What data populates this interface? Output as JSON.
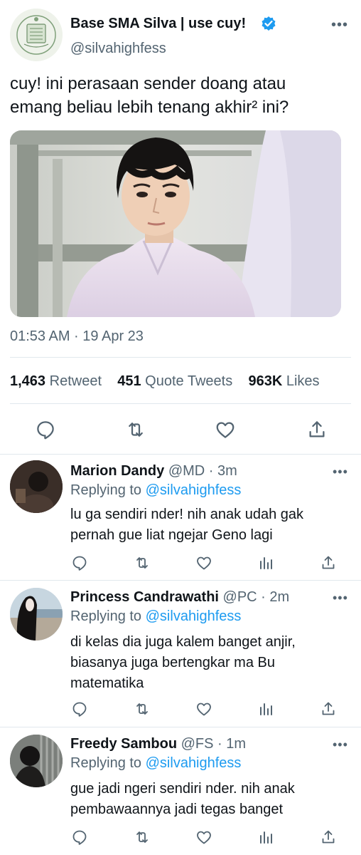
{
  "main_tweet": {
    "author_name": "Base SMA Silva | use cuy!",
    "author_handle": "@silvahighfess",
    "text_line1": "cuy! ini perasaan sender doang atau",
    "text_line2": "emang beliau lebih tenang akhir² ini?",
    "timestamp": "01:53 AM · 19 Apr 23",
    "stats": {
      "retweets": "1,463",
      "retweets_label": "Retweet",
      "quotes": "451",
      "quotes_label": "Quote Tweets",
      "likes": "963K",
      "likes_label": "Likes"
    },
    "more_label": "•••",
    "actions": [
      "reply-icon",
      "retweet-icon",
      "like-icon",
      "share-icon"
    ],
    "media_icon": "photo-of-student"
  },
  "replies": [
    {
      "name": "Marion Dandy",
      "meta": "@MD · 3m",
      "replying_prefix": "Replying to",
      "replying_mention": "@silvahighfess",
      "line1": "lu ga sendiri nder! nih anak udah gak",
      "line2": "pernah gue liat ngejar Geno lagi",
      "line3": ""
    },
    {
      "name": "Princess Candrawathi",
      "meta": "@PC · 2m",
      "replying_prefix": "Replying to",
      "replying_mention": "@silvahighfess",
      "line1": "di kelas dia juga kalem banget anjir,",
      "line2": "biasanya juga bertengkar ma Bu",
      "line3": "matematika"
    },
    {
      "name": "Freedy Sambou",
      "meta": "@FS · 1m",
      "replying_prefix": "Replying to",
      "replying_mention": "@silvahighfess",
      "line1": "gue jadi ngeri sendiri nder. nih anak",
      "line2": "pembawaannya jadi tegas banget",
      "line3": ""
    }
  ],
  "reply_more_label": "•••",
  "reply_actions": [
    "reply-icon",
    "retweet-icon",
    "like-icon",
    "analytics-icon",
    "share-icon"
  ],
  "colors": {
    "accent": "#1d9bf0",
    "text": "#0f1419",
    "muted": "#536471",
    "border": "#e1e8ed"
  }
}
